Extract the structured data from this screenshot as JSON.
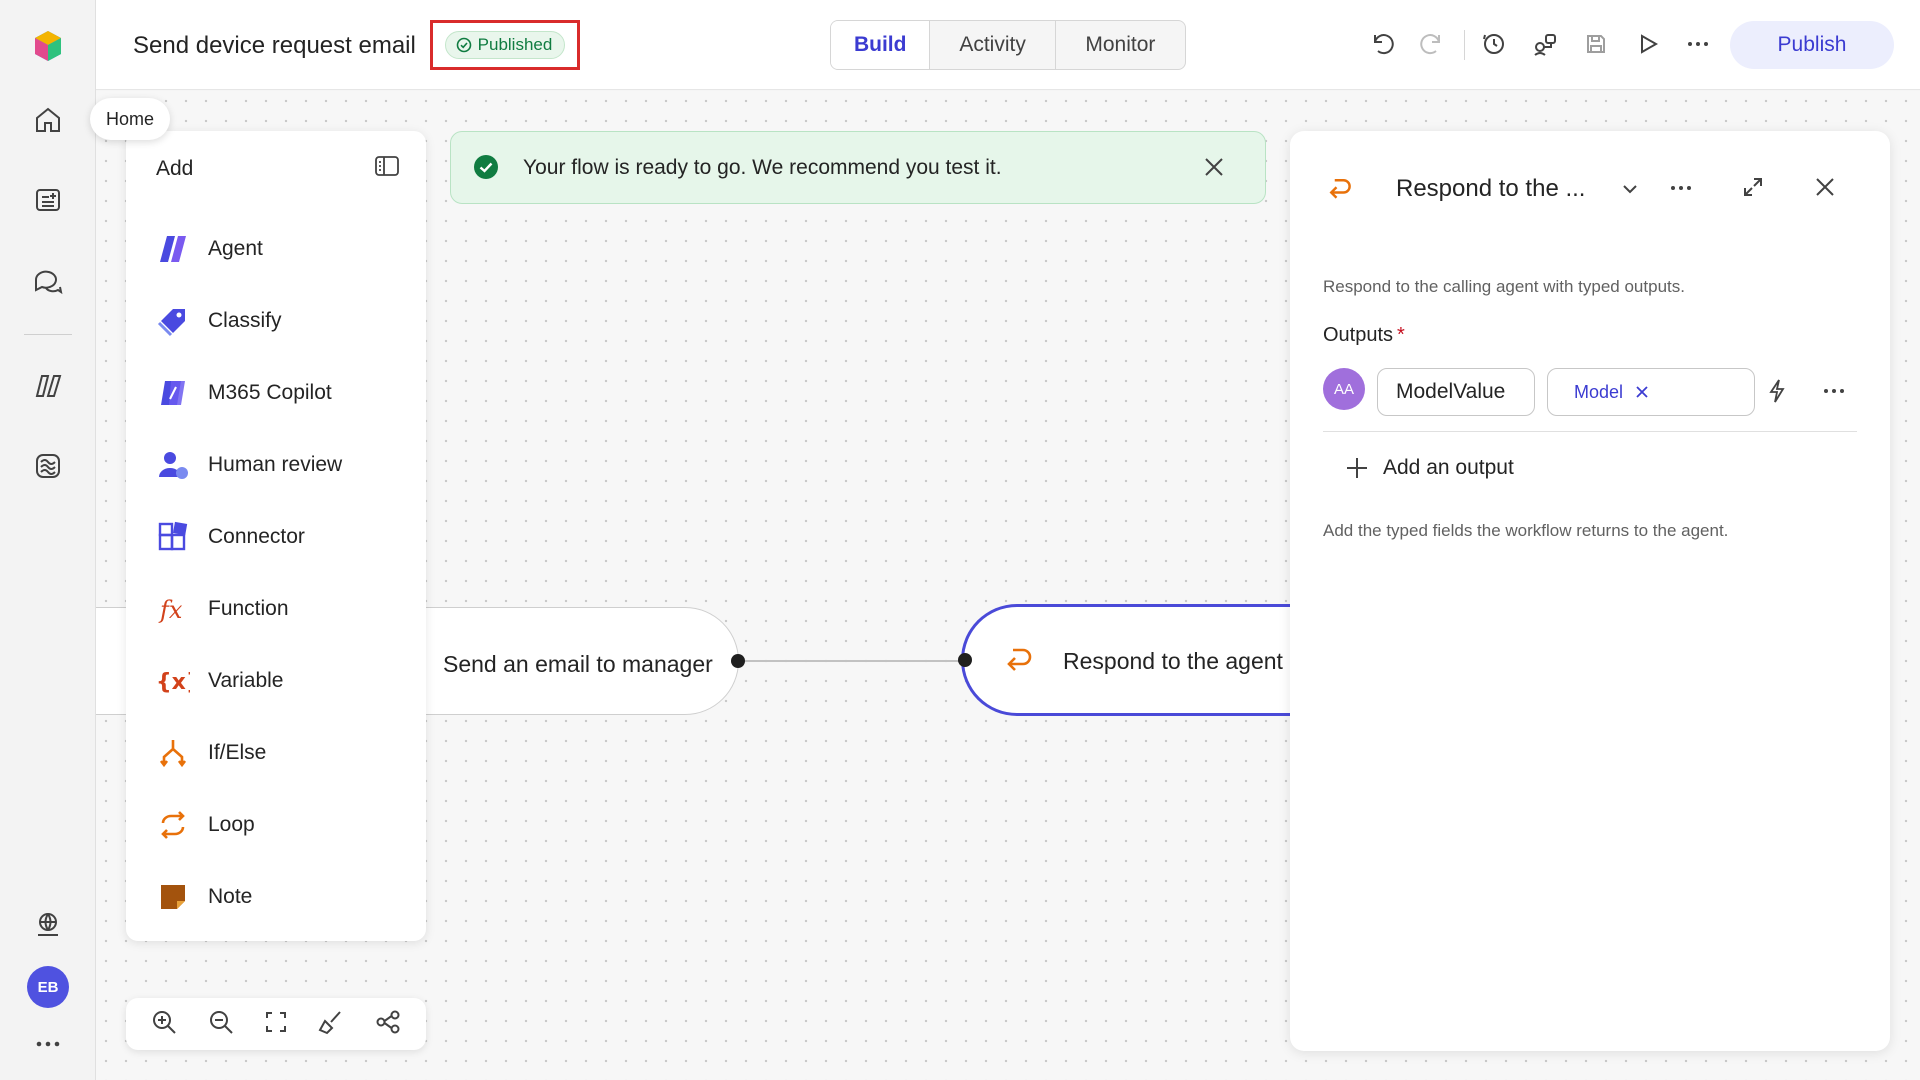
{
  "rail": {
    "tooltip": "Home",
    "avatar_initials": "EB",
    "icons": [
      "app-logo-icon",
      "home-icon",
      "create-icon",
      "chat-icon",
      "agents-icon",
      "flows-icon",
      "globe-icon",
      "more-icon"
    ]
  },
  "header": {
    "title": "Send device request email",
    "status_badge": "Published",
    "tabs": [
      {
        "label": "Build",
        "active": true
      },
      {
        "label": "Activity",
        "active": false
      },
      {
        "label": "Monitor",
        "active": false
      }
    ],
    "publish_label": "Publish"
  },
  "add_panel": {
    "title": "Add",
    "items": [
      {
        "label": "Agent",
        "icon": "agent-icon"
      },
      {
        "label": "Classify",
        "icon": "classify-icon"
      },
      {
        "label": "M365 Copilot",
        "icon": "copilot-icon"
      },
      {
        "label": "Human review",
        "icon": "human-review-icon"
      },
      {
        "label": "Connector",
        "icon": "connector-icon"
      },
      {
        "label": "Function",
        "icon": "function-icon"
      },
      {
        "label": "Variable",
        "icon": "variable-icon"
      },
      {
        "label": "If/Else",
        "icon": "if-else-icon"
      },
      {
        "label": "Loop",
        "icon": "loop-icon"
      },
      {
        "label": "Note",
        "icon": "note-icon"
      }
    ]
  },
  "toast": {
    "message": "Your flow is ready to go. We recommend you test it."
  },
  "flow": {
    "node_left": "Send an email to manager",
    "node_right": "Respond to the agent"
  },
  "right_panel": {
    "title": "Respond to the ...",
    "description": "Respond to the calling agent with typed outputs.",
    "outputs_label": "Outputs",
    "required_mark": "*",
    "type_avatar": "AA",
    "output_name": "ModelValue",
    "output_type": "Model",
    "add_output": "Add an output",
    "hint": "Add the typed fields the workflow returns to the agent."
  },
  "colors": {
    "accent": "#3b3bd1",
    "published": "#107c41",
    "toast_bg": "#e6f6ea",
    "highlight_frame": "#d92b2b",
    "orange": "#e8710a"
  }
}
